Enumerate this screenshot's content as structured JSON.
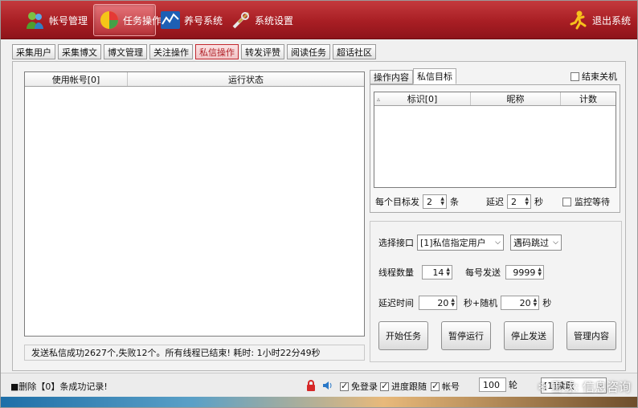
{
  "toolbar": {
    "account": "帐号管理",
    "task": "任务操作",
    "nurture": "养号系统",
    "settings": "系统设置",
    "exit": "退出系统"
  },
  "tabs": [
    "采集用户",
    "采集博文",
    "博文管理",
    "关注操作",
    "私信操作",
    "转发评赞",
    "阅读任务",
    "超话社区"
  ],
  "left_table": {
    "col_account": "使用帐号[0]",
    "col_status": "运行状态"
  },
  "status_line": "发送私信成功2627个,失败12个。所有线程已结束! 耗时: 1小时22分49秒",
  "right_tabs": {
    "op_content": "操作内容",
    "dm_target": "私信目标"
  },
  "shutdown_label": "结束关机",
  "right_table": {
    "sort_mark": "▵",
    "col_id": "标识[0]",
    "col_nick": "昵称",
    "col_count": "计数"
  },
  "per_target": {
    "label": "每个目标发",
    "value": "2",
    "unit": "条",
    "delay_label": "延迟",
    "delay_value": "2",
    "delay_unit": "秒",
    "monitor_label": "监控等待"
  },
  "interface": {
    "label": "选择接口",
    "value": "[1]私信指定用户",
    "captcha": "遇码跳过"
  },
  "threads": {
    "label": "线程数量",
    "value": "14",
    "per_account_label": "每号发送",
    "per_account_value": "9999"
  },
  "delay": {
    "label": "延迟时间",
    "value": "20",
    "random_label": "秒+随机",
    "random_value": "20",
    "unit": "秒"
  },
  "buttons": {
    "start": "开始任务",
    "pause": "暂停运行",
    "stop": "停止发送",
    "manage": "管理内容"
  },
  "bottom": {
    "delete_text": "■删除【0】条成功记录!",
    "auto_login": "免登录",
    "progress": "进度跟随",
    "acct_label": "帐号",
    "round_value": "100",
    "round_label": "轮",
    "mode_value": "[1]读取"
  },
  "watermark": "雪球: 信息咨询",
  "colors": {
    "toolbar": "#a81e24",
    "selected_tab": "#c2282f"
  }
}
